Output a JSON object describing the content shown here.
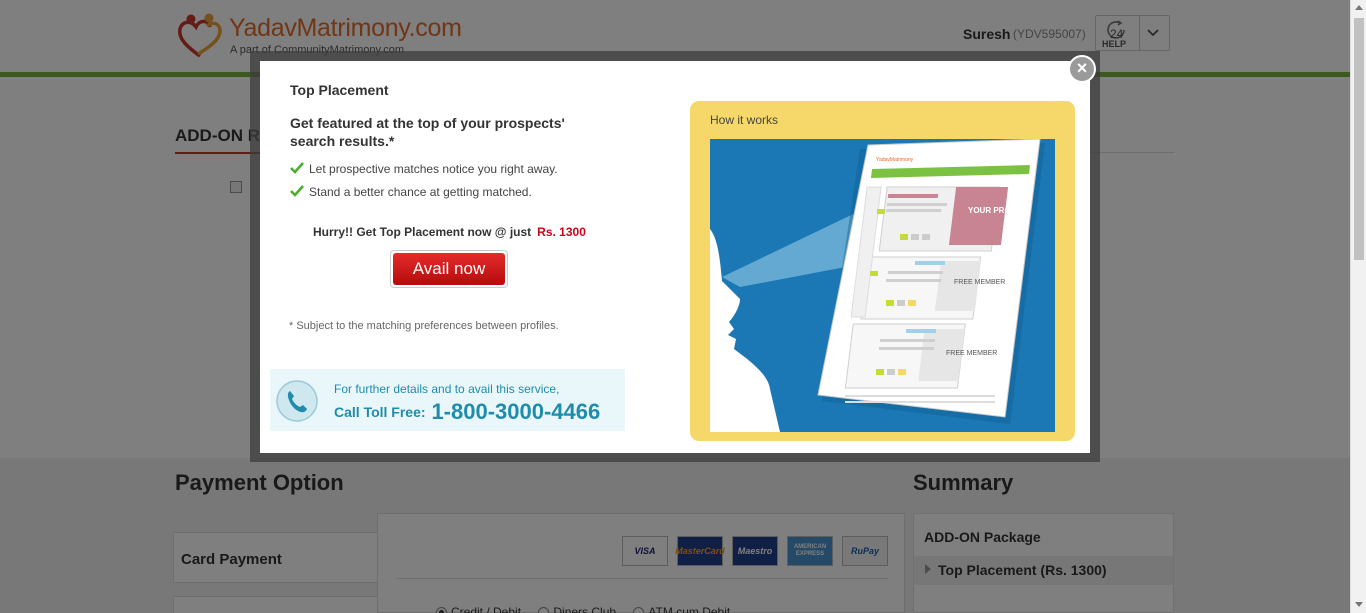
{
  "header": {
    "logo_name": "YadavMatrimony.com",
    "logo_sub": "A part of CommunityMatrimony.com",
    "user_name": "Suresh",
    "user_id": "(YDV595007)",
    "help_number": "24",
    "help_label": "HELP",
    "icons": [
      "logo-hearts-icon",
      "clock-24-icon",
      "chevron-down-icon"
    ]
  },
  "page": {
    "addon_heading": "ADD-ON R",
    "payment_heading": "Payment Option",
    "summary_heading": "Summary",
    "card_tab_label": "Card Payment",
    "card_brands": [
      "VISA",
      "MasterCard",
      "Maestro",
      "AMERICAN EXPRESS",
      "RuPay"
    ],
    "payment_types": [
      {
        "label": "Credit / Debit",
        "selected": true
      },
      {
        "label": "Diners Club",
        "selected": false
      },
      {
        "label": "ATM cum Debit",
        "selected": false
      }
    ],
    "summary_package_label": "ADD-ON Package",
    "summary_item": "Top Placement (Rs. 1300)"
  },
  "modal": {
    "title": "Top Placement",
    "headline": "Get featured at the top of your prospects' search results.*",
    "bullets": [
      "Let prospective matches notice you right away.",
      "Stand a better chance at getting matched."
    ],
    "hurry_text": "Hurry!! Get Top Placement now @ just",
    "price": "Rs. 1300",
    "avail_button": "Avail now",
    "note": "* Subject to the matching preferences between profiles.",
    "call_line1": "For further details and to avail this service,",
    "call_label": "Call Toll Free:",
    "call_number": "1-800-3000-4466",
    "how_label": "How it works",
    "illustration": {
      "profile_card": "YOUR PROFILE",
      "member_card_1": "FREE MEMBER",
      "member_card_2": "FREE MEMBER"
    },
    "close_symbol": "×"
  },
  "colors": {
    "brand_orange": "#e06c2a",
    "green_bar": "#78b43c",
    "price_red": "#d0021b",
    "button_red": "#c41414",
    "how_yellow": "#f6d86a",
    "illustration_blue": "#1b78b4",
    "call_teal": "#1f8cab"
  }
}
